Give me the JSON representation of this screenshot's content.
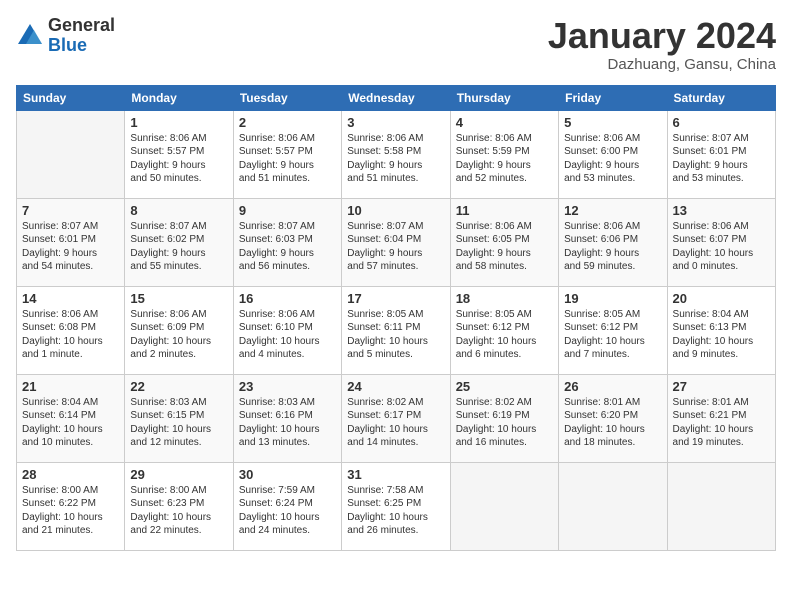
{
  "header": {
    "logo_line1": "General",
    "logo_line2": "Blue",
    "month": "January 2024",
    "location": "Dazhuang, Gansu, China"
  },
  "days_of_week": [
    "Sunday",
    "Monday",
    "Tuesday",
    "Wednesday",
    "Thursday",
    "Friday",
    "Saturday"
  ],
  "weeks": [
    [
      {
        "day": "",
        "text": ""
      },
      {
        "day": "1",
        "text": "Sunrise: 8:06 AM\nSunset: 5:57 PM\nDaylight: 9 hours\nand 50 minutes."
      },
      {
        "day": "2",
        "text": "Sunrise: 8:06 AM\nSunset: 5:57 PM\nDaylight: 9 hours\nand 51 minutes."
      },
      {
        "day": "3",
        "text": "Sunrise: 8:06 AM\nSunset: 5:58 PM\nDaylight: 9 hours\nand 51 minutes."
      },
      {
        "day": "4",
        "text": "Sunrise: 8:06 AM\nSunset: 5:59 PM\nDaylight: 9 hours\nand 52 minutes."
      },
      {
        "day": "5",
        "text": "Sunrise: 8:06 AM\nSunset: 6:00 PM\nDaylight: 9 hours\nand 53 minutes."
      },
      {
        "day": "6",
        "text": "Sunrise: 8:07 AM\nSunset: 6:01 PM\nDaylight: 9 hours\nand 53 minutes."
      }
    ],
    [
      {
        "day": "7",
        "text": "Sunrise: 8:07 AM\nSunset: 6:01 PM\nDaylight: 9 hours\nand 54 minutes."
      },
      {
        "day": "8",
        "text": "Sunrise: 8:07 AM\nSunset: 6:02 PM\nDaylight: 9 hours\nand 55 minutes."
      },
      {
        "day": "9",
        "text": "Sunrise: 8:07 AM\nSunset: 6:03 PM\nDaylight: 9 hours\nand 56 minutes."
      },
      {
        "day": "10",
        "text": "Sunrise: 8:07 AM\nSunset: 6:04 PM\nDaylight: 9 hours\nand 57 minutes."
      },
      {
        "day": "11",
        "text": "Sunrise: 8:06 AM\nSunset: 6:05 PM\nDaylight: 9 hours\nand 58 minutes."
      },
      {
        "day": "12",
        "text": "Sunrise: 8:06 AM\nSunset: 6:06 PM\nDaylight: 9 hours\nand 59 minutes."
      },
      {
        "day": "13",
        "text": "Sunrise: 8:06 AM\nSunset: 6:07 PM\nDaylight: 10 hours\nand 0 minutes."
      }
    ],
    [
      {
        "day": "14",
        "text": "Sunrise: 8:06 AM\nSunset: 6:08 PM\nDaylight: 10 hours\nand 1 minute."
      },
      {
        "day": "15",
        "text": "Sunrise: 8:06 AM\nSunset: 6:09 PM\nDaylight: 10 hours\nand 2 minutes."
      },
      {
        "day": "16",
        "text": "Sunrise: 8:06 AM\nSunset: 6:10 PM\nDaylight: 10 hours\nand 4 minutes."
      },
      {
        "day": "17",
        "text": "Sunrise: 8:05 AM\nSunset: 6:11 PM\nDaylight: 10 hours\nand 5 minutes."
      },
      {
        "day": "18",
        "text": "Sunrise: 8:05 AM\nSunset: 6:12 PM\nDaylight: 10 hours\nand 6 minutes."
      },
      {
        "day": "19",
        "text": "Sunrise: 8:05 AM\nSunset: 6:12 PM\nDaylight: 10 hours\nand 7 minutes."
      },
      {
        "day": "20",
        "text": "Sunrise: 8:04 AM\nSunset: 6:13 PM\nDaylight: 10 hours\nand 9 minutes."
      }
    ],
    [
      {
        "day": "21",
        "text": "Sunrise: 8:04 AM\nSunset: 6:14 PM\nDaylight: 10 hours\nand 10 minutes."
      },
      {
        "day": "22",
        "text": "Sunrise: 8:03 AM\nSunset: 6:15 PM\nDaylight: 10 hours\nand 12 minutes."
      },
      {
        "day": "23",
        "text": "Sunrise: 8:03 AM\nSunset: 6:16 PM\nDaylight: 10 hours\nand 13 minutes."
      },
      {
        "day": "24",
        "text": "Sunrise: 8:02 AM\nSunset: 6:17 PM\nDaylight: 10 hours\nand 14 minutes."
      },
      {
        "day": "25",
        "text": "Sunrise: 8:02 AM\nSunset: 6:19 PM\nDaylight: 10 hours\nand 16 minutes."
      },
      {
        "day": "26",
        "text": "Sunrise: 8:01 AM\nSunset: 6:20 PM\nDaylight: 10 hours\nand 18 minutes."
      },
      {
        "day": "27",
        "text": "Sunrise: 8:01 AM\nSunset: 6:21 PM\nDaylight: 10 hours\nand 19 minutes."
      }
    ],
    [
      {
        "day": "28",
        "text": "Sunrise: 8:00 AM\nSunset: 6:22 PM\nDaylight: 10 hours\nand 21 minutes."
      },
      {
        "day": "29",
        "text": "Sunrise: 8:00 AM\nSunset: 6:23 PM\nDaylight: 10 hours\nand 22 minutes."
      },
      {
        "day": "30",
        "text": "Sunrise: 7:59 AM\nSunset: 6:24 PM\nDaylight: 10 hours\nand 24 minutes."
      },
      {
        "day": "31",
        "text": "Sunrise: 7:58 AM\nSunset: 6:25 PM\nDaylight: 10 hours\nand 26 minutes."
      },
      {
        "day": "",
        "text": ""
      },
      {
        "day": "",
        "text": ""
      },
      {
        "day": "",
        "text": ""
      }
    ]
  ]
}
